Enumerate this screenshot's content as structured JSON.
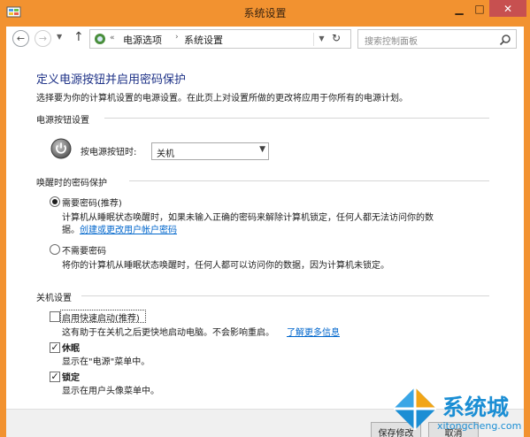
{
  "window": {
    "title": "系统设置"
  },
  "nav": {
    "breadcrumb": [
      "电源选项",
      "系统设置"
    ],
    "breadcrumb_prefix": "«",
    "search_placeholder": "搜索控制面板"
  },
  "page": {
    "heading": "定义电源按钮并启用密码保护",
    "description": "选择要为你的计算机设置的电源设置。在此页上对设置所做的更改将应用于你所有的电源计划。"
  },
  "power_buttons": {
    "group_title": "电源按钮设置",
    "label": "按电源按钮时:",
    "selected": "关机"
  },
  "wake_password": {
    "group_title": "唤醒时的密码保护",
    "options": [
      {
        "label": "需要密码(推荐)",
        "description": "计算机从睡眠状态唤醒时，如果未输入正确的密码来解除计算机锁定，任何人都无法访问你的数",
        "description2": "据。",
        "link": "创建或更改用户帐户密码",
        "selected": true
      },
      {
        "label": "不需要密码",
        "description": "将你的计算机从睡眠状态唤醒时，任何人都可以访问你的数据，因为计算机未锁定。",
        "selected": false
      }
    ]
  },
  "shutdown": {
    "group_title": "关机设置",
    "items": [
      {
        "label": "启用快速启动(推荐)",
        "description": "这有助于在关机之后更快地启动电脑。不会影响重启。",
        "link": "了解更多信息",
        "checked": false
      },
      {
        "label": "休眠",
        "description": "显示在\"电源\"菜单中。",
        "checked": true
      },
      {
        "label": "锁定",
        "description": "显示在用户头像菜单中。",
        "checked": true
      }
    ]
  },
  "footer": {
    "save_label": "保存修改",
    "cancel_label": "取消"
  },
  "watermark": {
    "brand": "系统城",
    "url": "xitongcheng.com"
  },
  "colors": {
    "titlebar": "#f29230",
    "close": "#c75050",
    "heading": "#1e3287",
    "link": "#0066cc",
    "watermark": "#1b8ed4"
  }
}
